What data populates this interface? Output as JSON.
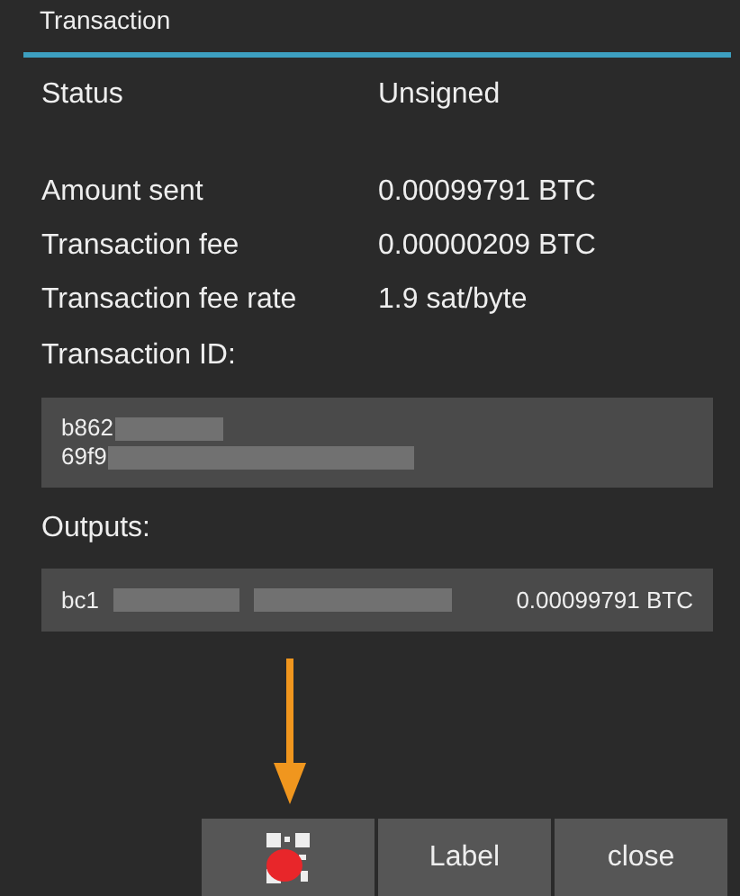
{
  "window": {
    "title": "Transaction"
  },
  "status": {
    "label": "Status",
    "value": "Unsigned"
  },
  "details": [
    {
      "label": "Amount sent",
      "value": "0.00099791 BTC"
    },
    {
      "label": "Transaction fee",
      "value": "0.00000209 BTC"
    },
    {
      "label": "Transaction fee rate",
      "value": "1.9 sat/byte"
    }
  ],
  "transaction_id": {
    "label": "Transaction ID:",
    "lines": [
      "b862",
      "69f9"
    ]
  },
  "outputs": {
    "label": "Outputs:",
    "items": [
      {
        "address": "bc1",
        "amount": "0.00099791 BTC"
      }
    ]
  },
  "buttons": [
    {
      "kind": "qr"
    },
    {
      "kind": "text",
      "label": "Label"
    },
    {
      "kind": "text",
      "label": "close"
    }
  ]
}
